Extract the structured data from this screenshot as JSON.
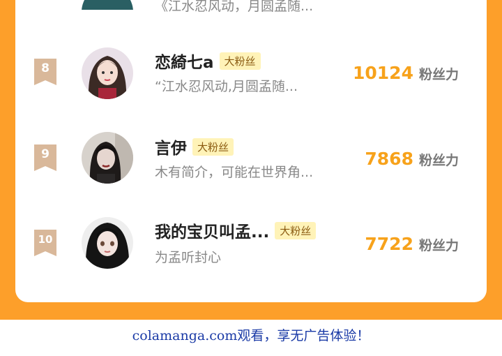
{
  "top_partial": {
    "bio": "《江水忍风动，月圆孟随..."
  },
  "rows": [
    {
      "rank": "8",
      "name": "恋綺七a",
      "tag": "大粉丝",
      "bio": "“江水忍风动,月圆孟随...",
      "score": "10124",
      "unit": "粉丝力"
    },
    {
      "rank": "9",
      "name": "言伊",
      "tag": "大粉丝",
      "bio": "木有简介，可能在世界角...",
      "score": "7868",
      "unit": "粉丝力"
    },
    {
      "rank": "10",
      "name": "我的宝贝叫孟...",
      "tag": "大粉丝",
      "bio": "为孟听封心",
      "score": "7722",
      "unit": "粉丝力"
    }
  ],
  "footer": {
    "text": "colamanga.com观看，享无广告体验！"
  },
  "colors": {
    "accent": "#fd9f2a",
    "score": "#f7a21b",
    "tag_bg": "#fff3b8",
    "badge": "#d9b89a",
    "link": "#1a3aa6"
  },
  "icons": {
    "rank_badge": "ribbon-bookmark-icon"
  }
}
